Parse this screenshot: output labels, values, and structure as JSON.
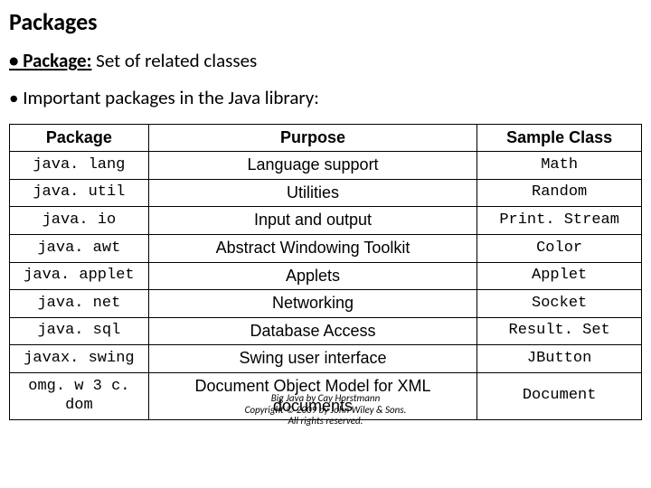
{
  "title": "Packages",
  "bullets": {
    "b1_leader": "• Package:",
    "b1_rest": " Set of related classes",
    "b2": "• Important packages in the Java library:"
  },
  "headers": {
    "c1": "Package",
    "c2": "Purpose",
    "c3": "Sample Class"
  },
  "rows": [
    {
      "pkg": "java. lang",
      "purpose": "Language support",
      "sample": "Math"
    },
    {
      "pkg": "java. util",
      "purpose": "Utilities",
      "sample": "Random"
    },
    {
      "pkg": "java. io",
      "purpose": "Input and output",
      "sample": "Print. Stream"
    },
    {
      "pkg": "java. awt",
      "purpose": "Abstract Windowing Toolkit",
      "sample": "Color"
    },
    {
      "pkg": "java. applet",
      "purpose": "Applets",
      "sample": "Applet"
    },
    {
      "pkg": "java. net",
      "purpose": "Networking",
      "sample": "Socket"
    },
    {
      "pkg": "java. sql",
      "purpose": "Database Access",
      "sample": "Result. Set"
    },
    {
      "pkg": "javax. swing",
      "purpose": "Swing user interface",
      "sample": "JButton"
    },
    {
      "pkg": "omg. w 3 c. dom",
      "purpose": "Document Object Model for XML documents",
      "sample": "Document"
    }
  ],
  "footer": {
    "line1": "Big Java by Cay Horstmann",
    "line2": "Copyright © 2009 by John Wiley & Sons.",
    "line3": "All rights reserved."
  }
}
